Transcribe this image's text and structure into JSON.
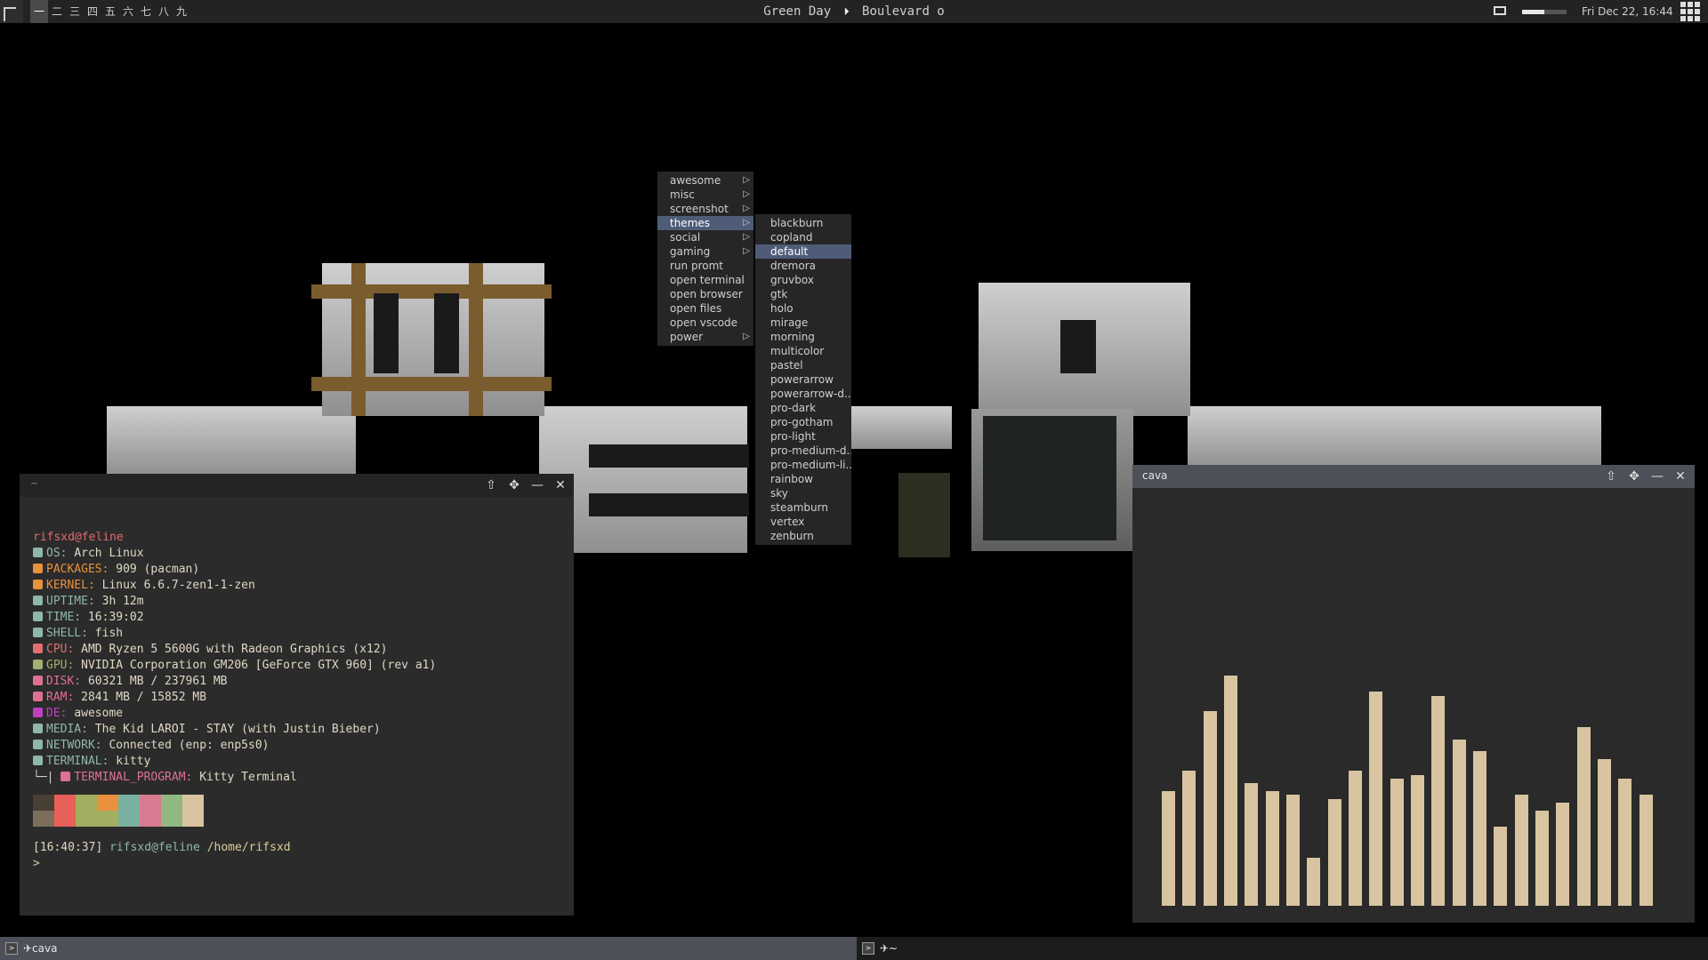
{
  "topbar": {
    "tags": [
      "一",
      "二",
      "三",
      "四",
      "五",
      "六",
      "七",
      "八",
      "九"
    ],
    "active_tag": 0,
    "now_playing": {
      "artist": "Green Day",
      "separator": "⏵",
      "title": "Boulevard o"
    },
    "volume_percent": 50,
    "clock": "Fri Dec 22, 16:44"
  },
  "main_menu": {
    "items": [
      {
        "label": "awesome",
        "submenu": true
      },
      {
        "label": "misc",
        "submenu": true
      },
      {
        "label": "screenshot",
        "submenu": true
      },
      {
        "label": "themes",
        "submenu": true,
        "selected": true
      },
      {
        "label": "social",
        "submenu": true
      },
      {
        "label": "gaming",
        "submenu": true
      },
      {
        "label": "run promt",
        "submenu": false
      },
      {
        "label": "open terminal",
        "submenu": false
      },
      {
        "label": "open browser",
        "submenu": false
      },
      {
        "label": "open files",
        "submenu": false
      },
      {
        "label": "open vscode",
        "submenu": false
      },
      {
        "label": "power",
        "submenu": true
      }
    ]
  },
  "themes_menu": {
    "items": [
      "blackburn",
      "copland",
      "default",
      "dremora",
      "gruvbox",
      "gtk",
      "holo",
      "mirage",
      "morning",
      "multicolor",
      "pastel",
      "powerarrow",
      "powerarrow-d...",
      "pro-dark",
      "pro-gotham",
      "pro-light",
      "pro-medium-d...",
      "pro-medium-li...",
      "rainbow",
      "sky",
      "steamburn",
      "vertex",
      "zenburn"
    ],
    "selected_index": 2
  },
  "terminal": {
    "title": "~",
    "user_host": "rifsxd@feline",
    "info": [
      {
        "key": "OS:",
        "value": "Arch Linux",
        "color": "#8fb8a8",
        "icon": "monitor-icon"
      },
      {
        "key": "PACKAGES:",
        "value": "909 (pacman)",
        "color": "#e8913c",
        "icon": "package-icon"
      },
      {
        "key": "KERNEL:",
        "value": "Linux 6.6.7-zen1-1-zen",
        "color": "#e8913c",
        "icon": "penguin-icon"
      },
      {
        "key": "UPTIME:",
        "value": "3h 12m",
        "color": "#8fb8a8",
        "icon": "uptime-icon"
      },
      {
        "key": "TIME:",
        "value": "16:39:02",
        "color": "#8fb8a8",
        "icon": "clock-icon"
      },
      {
        "key": "SHELL:",
        "value": "fish",
        "color": "#8fb8a8",
        "icon": "shell-icon"
      },
      {
        "key": "CPU:",
        "value": "AMD Ryzen 5 5600G with Radeon Graphics (x12)",
        "color": "#e07070",
        "icon": "cpu-icon"
      },
      {
        "key": "GPU:",
        "value": "NVIDIA Corporation GM206 [GeForce GTX 960] (rev a1)",
        "color": "#a0b070",
        "icon": "gpu-icon"
      },
      {
        "key": "DISK:",
        "value": "60321 MB / 237961 MB",
        "color": "#e07090",
        "icon": "disk-icon"
      },
      {
        "key": "RAM:",
        "value": "2841 MB / 15852 MB",
        "color": "#e07090",
        "icon": "ram-icon"
      },
      {
        "key": "DE:",
        "value": "awesome",
        "color": "#c040c0",
        "icon": "desktop-icon"
      },
      {
        "key": "MEDIA:",
        "value": "The Kid LAROI - STAY (with Justin Bieber)",
        "color": "#8fb8a8",
        "icon": "media-icon"
      },
      {
        "key": "NETWORK:",
        "value": "Connected (enp: enp5s0)",
        "color": "#8fb8a8",
        "icon": "network-icon"
      },
      {
        "key": "TERMINAL:",
        "value": "kitty",
        "color": "#8fb8a8",
        "icon": "terminal-icon"
      },
      {
        "key": "TERMINAL_PROGRAM:",
        "value": "Kitty Terminal",
        "color": "#e07090",
        "icon": "terminal-program-icon",
        "prefix": "└─| "
      }
    ],
    "palette": [
      [
        "#4a3f35",
        "#7d6e5c"
      ],
      [
        "#e8605a",
        "#e8605a"
      ],
      [
        "#a0b060",
        "#a0b060"
      ],
      [
        "#e8913c",
        "#a0b060"
      ],
      [
        "#7ab0a0",
        "#7ab0a0"
      ],
      [
        "#d87a90",
        "#d87a90"
      ],
      [
        "#90b880",
        "#90b880"
      ],
      [
        "#d8c4a0",
        "#d8c4a0"
      ]
    ],
    "prompt_time": "[16:40:37]",
    "prompt_user": "rifsxd@feline",
    "prompt_path": "/home/rifsxd",
    "prompt_char": ">"
  },
  "cava": {
    "title": "cava",
    "bar_color": "#d8c4a0",
    "bars": [
      0.29,
      0.34,
      0.49,
      0.58,
      0.31,
      0.29,
      0.28,
      0.12,
      0.27,
      0.34,
      0.54,
      0.32,
      0.33,
      0.53,
      0.42,
      0.39,
      0.2,
      0.28,
      0.24,
      0.26,
      0.45,
      0.37,
      0.32,
      0.28
    ]
  },
  "taskbar": {
    "tasks": [
      {
        "label": "✈cava",
        "focused": true
      },
      {
        "label": "✈~",
        "focused": false
      }
    ]
  }
}
